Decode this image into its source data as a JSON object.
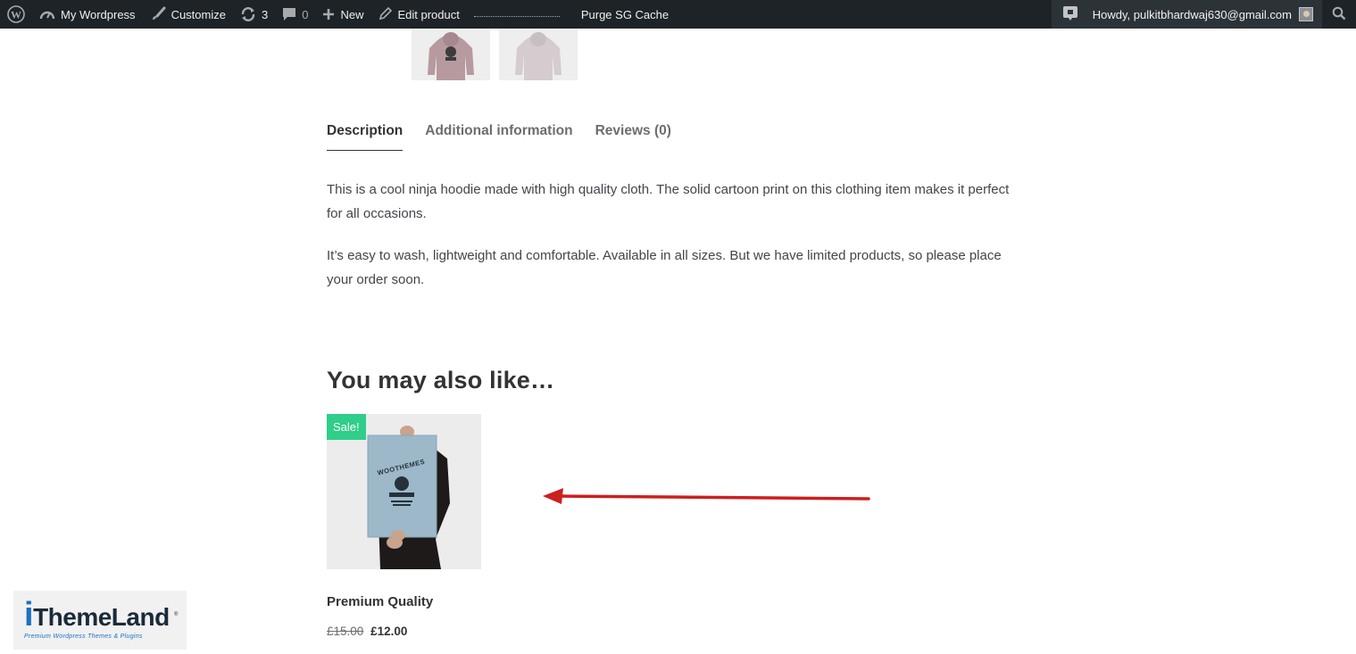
{
  "adminbar": {
    "site_name": "My Wordpress",
    "customize": "Customize",
    "updates_count": "3",
    "comments_count": "0",
    "new_label": "New",
    "edit_label": "Edit product",
    "purge_label": "Purge SG Cache",
    "howdy": "Howdy, pulkitbhardwaj630@gmail.com"
  },
  "tabs": [
    {
      "label": "Description"
    },
    {
      "label": "Additional information"
    },
    {
      "label": "Reviews (0)"
    }
  ],
  "description": {
    "p1": "This is a cool ninja hoodie made with high quality cloth. The solid cartoon print on this clothing item makes it perfect for all occasions.",
    "p2": "It’s easy to wash, lightweight and comfortable. Available in all sizes. But we have limited products, so please place your order soon."
  },
  "related": {
    "title": "You may also like…",
    "product": {
      "sale_badge": "Sale!",
      "poster_text": "WOOTHEMES",
      "name": "Premium Quality",
      "old_price": "£15.00",
      "new_price": "£12.00"
    }
  },
  "watermark": {
    "brand": "ThemeLand",
    "tagline": "Premium Wordpress Themes & Plugins"
  },
  "colors": {
    "adminbar_bg": "#1d2327",
    "sale_badge": "#2fce89",
    "arrow": "#cc1f1f",
    "brand_blue": "#1c6fc0"
  }
}
